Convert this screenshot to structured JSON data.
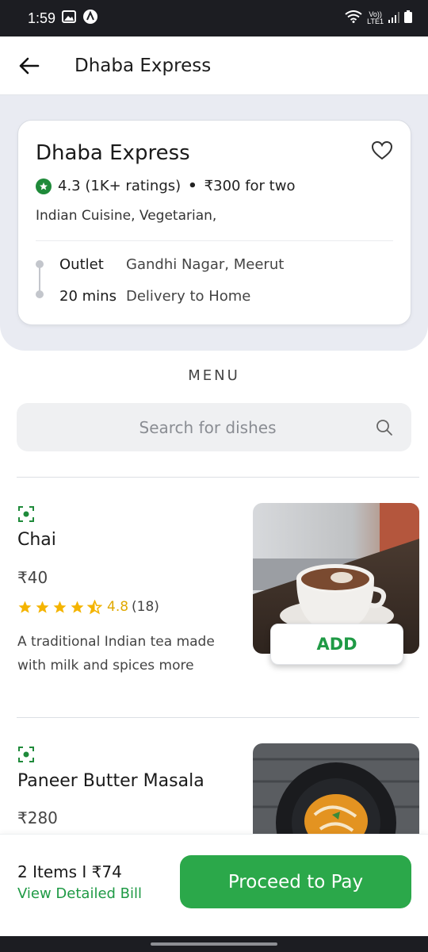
{
  "status_bar": {
    "time": "1:59",
    "network_top": "Vo))",
    "network_bottom": "LTE1"
  },
  "app_bar": {
    "title": "Dhaba Express"
  },
  "restaurant": {
    "name": "Dhaba Express",
    "rating": "4.3 (1K+ ratings)",
    "cost_for_two": "₹300 for two",
    "cuisine": "Indian Cuisine, Vegetarian,",
    "outlet_label": "Outlet",
    "outlet_value": "Gandhi Nagar, Meerut",
    "time_label": "20 mins",
    "time_value": "Delivery to Home"
  },
  "menu": {
    "heading": "MENU",
    "search_placeholder": "Search for dishes",
    "items": [
      {
        "name": "Chai",
        "price": "₹40",
        "rating_value": "4.8",
        "rating_count": "(18)",
        "stars": 4.5,
        "description": "A traditional Indian tea made with milk and spices more",
        "add_label": "ADD"
      },
      {
        "name": "Paneer Butter Masala",
        "price": "₹280"
      }
    ]
  },
  "cart": {
    "summary": "2 Items I  ₹74",
    "bill_link": "View Detailed Bill",
    "pay_label": "Proceed to Pay"
  },
  "colors": {
    "accent_green": "#2ba84a",
    "star_yellow": "#f4b400",
    "veg_green": "#1f8a3a"
  }
}
